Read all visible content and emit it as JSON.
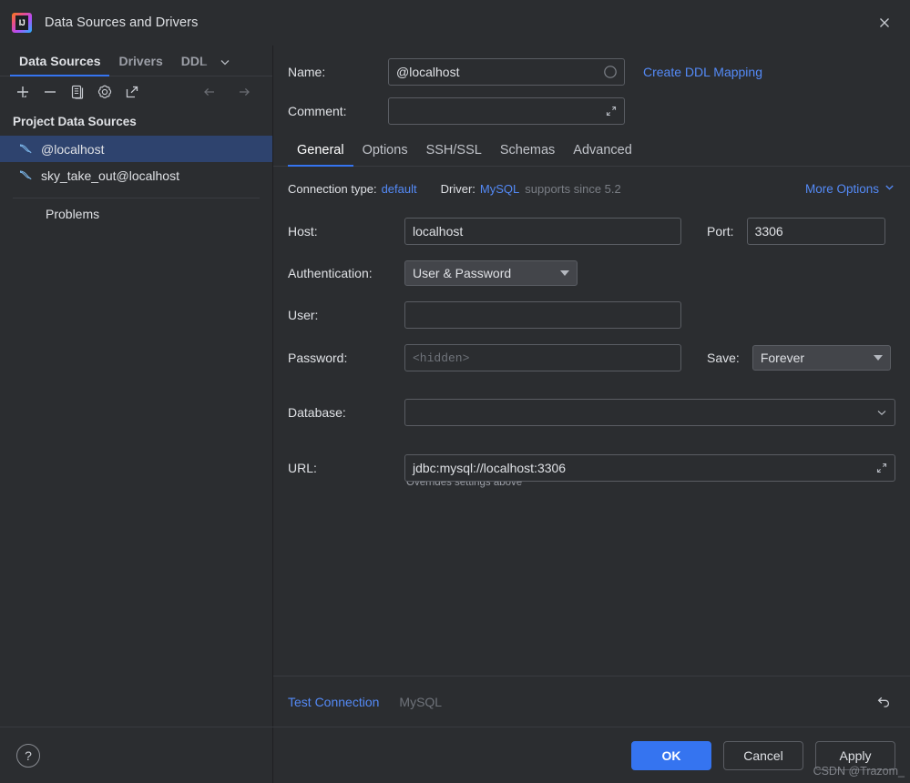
{
  "window": {
    "title": "Data Sources and Drivers",
    "app_icon": "intellij-idea-icon",
    "close_label": "✕"
  },
  "sidebar": {
    "tabs": [
      {
        "label": "Data Sources",
        "active": true
      },
      {
        "label": "Drivers",
        "active": false
      },
      {
        "label": "DDL",
        "active": false,
        "truncated": true
      }
    ],
    "tab_overflow_icon": "chevron-down-icon",
    "toolbar": [
      {
        "name": "add-data-source-button",
        "icon": "plus-icon"
      },
      {
        "name": "remove-data-source-button",
        "icon": "minus-icon"
      },
      {
        "name": "duplicate-data-source-button",
        "icon": "copy-icon"
      },
      {
        "name": "settings-button",
        "icon": "gear-icon"
      },
      {
        "name": "open-externally-button",
        "icon": "external-link-icon"
      },
      {
        "name": "navigate-back-button",
        "icon": "arrow-left-icon"
      },
      {
        "name": "navigate-forward-button",
        "icon": "arrow-right-icon"
      }
    ],
    "section_title": "Project Data Sources",
    "items": [
      {
        "label": "@localhost",
        "icon": "mysql-dolphin-icon",
        "selected": true
      },
      {
        "label": "sky_take_out@localhost",
        "icon": "mysql-dolphin-icon",
        "selected": false
      }
    ],
    "problems_label": "Problems",
    "help_label": "?"
  },
  "form": {
    "name_label": "Name:",
    "name_value": "@localhost",
    "name_field_icon": "circle-status-icon",
    "comment_label": "Comment:",
    "comment_value": "",
    "comment_placeholder": "",
    "comment_expand_icon": "expand-icon",
    "create_ddl_mapping": "Create DDL Mapping"
  },
  "tabs": [
    {
      "label": "General",
      "active": true
    },
    {
      "label": "Options",
      "active": false
    },
    {
      "label": "SSH/SSL",
      "active": false
    },
    {
      "label": "Schemas",
      "active": false
    },
    {
      "label": "Advanced",
      "active": false
    }
  ],
  "general": {
    "connection_type_label": "Connection type:",
    "connection_type_value": "default",
    "driver_label": "Driver:",
    "driver_value": "MySQL",
    "driver_note": "supports since 5.2",
    "more_options_label": "More Options",
    "more_options_icon": "chevron-down-icon",
    "host_label": "Host:",
    "host_value": "localhost",
    "port_label": "Port:",
    "port_value": "3306",
    "auth_label": "Authentication:",
    "auth_value": "User & Password",
    "user_label": "User:",
    "user_value": "",
    "password_label": "Password:",
    "password_placeholder": "<hidden>",
    "password_value": "",
    "save_label": "Save:",
    "save_value": "Forever",
    "database_label": "Database:",
    "database_value": "",
    "url_label": "URL:",
    "url_value": "jdbc:mysql://localhost:3306",
    "url_expand_icon": "expand-icon",
    "url_hint": "Overrides settings above"
  },
  "footer_actions": {
    "test_connection": "Test Connection",
    "driver_status": "MySQL",
    "revert_icon": "revert-icon",
    "ok": "OK",
    "cancel": "Cancel",
    "apply": "Apply"
  },
  "watermark": "CSDN @Trazom_",
  "colors": {
    "accent": "#3574f0",
    "link": "#548af7",
    "bg": "#2b2d30",
    "selected_row": "#2e436e",
    "border": "#5a5d63"
  }
}
